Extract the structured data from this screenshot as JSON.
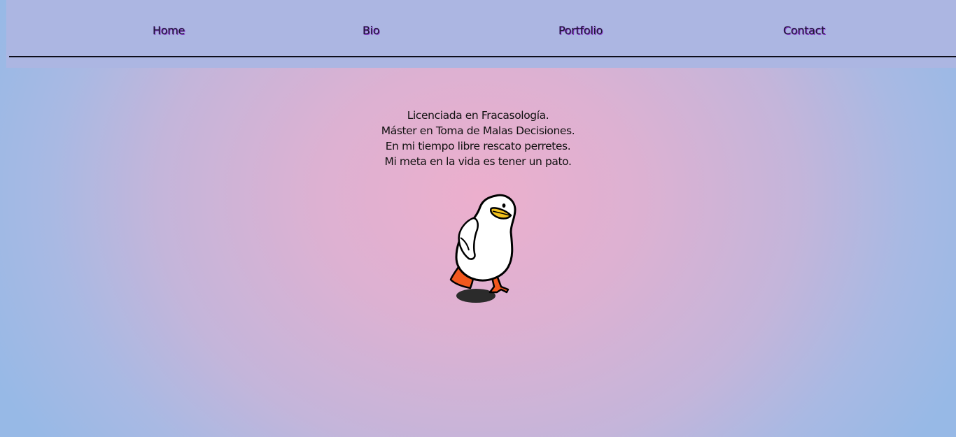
{
  "nav": {
    "items": [
      {
        "label": "Home"
      },
      {
        "label": "Bio"
      },
      {
        "label": "Portfolio"
      },
      {
        "label": "Contact"
      }
    ]
  },
  "bio": {
    "lines": [
      "Licenciada en Fracasología.",
      "Máster en Toma de Malas Decisiones.",
      "En mi tiempo libre rescato perretes.",
      "Mi meta en la vida es tener un pato."
    ]
  },
  "colors": {
    "navbar_bg": "#acb6e2",
    "gradient_center": "#ecafcd",
    "gradient_edge": "#97b9e6",
    "link_shadow": "#8a3ad0"
  },
  "image": {
    "icon": "duck-illustration"
  }
}
